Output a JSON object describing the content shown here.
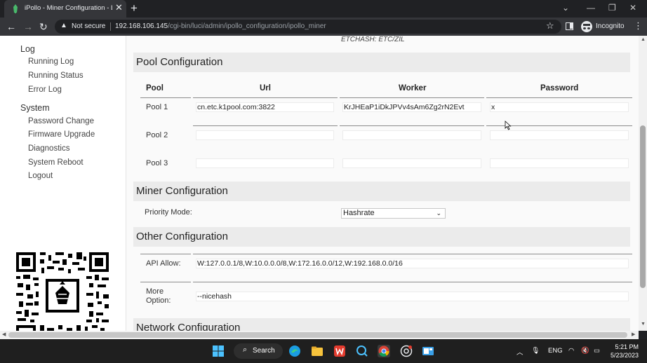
{
  "browser": {
    "tab_title": "iPollo - Miner Configuration - LuCI",
    "new_tab": "+",
    "close_tab": "✕",
    "not_secure": "Not secure",
    "url_host": "192.168.106.145",
    "url_path": "/cgi-bin/luci/admin/ipollo_configuration/ipollo_miner",
    "profile_label": "Incognito"
  },
  "sidebar": {
    "log_header": "Log",
    "log_items": [
      "Running Log",
      "Running Status",
      "Error Log"
    ],
    "system_header": "System",
    "system_items": [
      "Password Change",
      "Firmware Upgrade",
      "Diagnostics",
      "System Reboot",
      "Logout"
    ]
  },
  "main": {
    "algo_note": "ETCHASH: ETC/ZIL",
    "pool_section": {
      "title": "Pool Configuration",
      "headers": [
        "Pool",
        "Url",
        "Worker",
        "Password"
      ],
      "rows": [
        {
          "label": "Pool 1",
          "url": "cn.etc.k1pool.com:3822",
          "worker": "KrJHEaP1iDkJPVv4sAm6Zg2rN2Evt",
          "password": "x"
        },
        {
          "label": "Pool 2",
          "url": "",
          "worker": "",
          "password": ""
        },
        {
          "label": "Pool 3",
          "url": "",
          "worker": "",
          "password": ""
        }
      ]
    },
    "miner_section": {
      "title": "Miner Configuration",
      "priority_label": "Priority Mode:",
      "priority_value": "Hashrate"
    },
    "other_section": {
      "title": "Other Configuration",
      "api_label": "API Allow:",
      "api_value": "W:127.0.0.1/8,W:10.0.0.0/8,W:172.16.0.0/12,W:192.168.0.0/16",
      "more_label_1": "More",
      "more_label_2": "Option:",
      "more_value": "--nicehash"
    },
    "network_section": {
      "title": "Network Configuration"
    }
  },
  "taskbar": {
    "search_label": "Search",
    "language": "ENG",
    "time": "5:21 PM",
    "date": "5/23/2023"
  },
  "colors": {
    "chrome_dark": "#202124",
    "chrome_toolbar": "#35363a",
    "section_bg": "#ebebeb",
    "taskbar_bg": "#1f1f1f"
  }
}
